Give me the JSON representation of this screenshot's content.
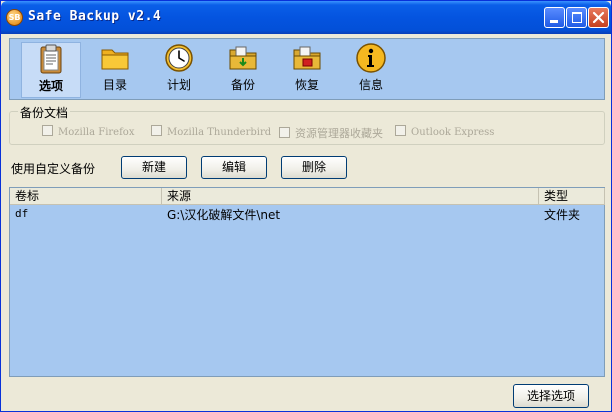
{
  "window": {
    "title": "Safe Backup v2.4",
    "icon_text": "SB",
    "accent": "#0454e0"
  },
  "toolbar": {
    "items": [
      {
        "label": "选项",
        "icon": "clipboard-icon",
        "active": true
      },
      {
        "label": "目录",
        "icon": "folder-icon",
        "active": false
      },
      {
        "label": "计划",
        "icon": "clock-icon",
        "active": false
      },
      {
        "label": "备份",
        "icon": "backup-folder-icon",
        "active": false
      },
      {
        "label": "恢复",
        "icon": "restore-folder-icon",
        "active": false
      },
      {
        "label": "信息",
        "icon": "info-icon",
        "active": false
      }
    ]
  },
  "backup_docs": {
    "label": "备份文档",
    "options": [
      {
        "label": "Mozilla Firefox",
        "checked": false,
        "enabled": false
      },
      {
        "label": "Mozilla Thunderbird",
        "checked": false,
        "enabled": false
      },
      {
        "label": "资源管理器收藏夹",
        "checked": false,
        "enabled": false
      },
      {
        "label": "Outlook Express",
        "checked": false,
        "enabled": false
      }
    ]
  },
  "custom_backup": {
    "label": "使用自定义备份",
    "new_label": "新建",
    "edit_label": "编辑",
    "delete_label": "删除"
  },
  "list": {
    "columns": [
      "卷标",
      "来源",
      "类型"
    ],
    "rows": [
      {
        "volume": "df",
        "source": "G:\\汉化破解文件\\net",
        "type": "文件夹"
      }
    ]
  },
  "footer": {
    "options_label": "选择选项"
  }
}
